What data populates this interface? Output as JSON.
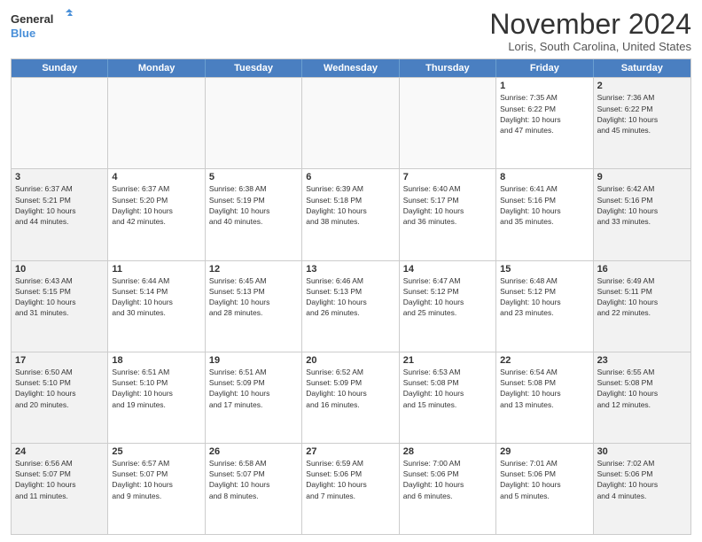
{
  "logo": {
    "line1": "General",
    "line2": "Blue"
  },
  "title": "November 2024",
  "location": "Loris, South Carolina, United States",
  "weekdays": [
    "Sunday",
    "Monday",
    "Tuesday",
    "Wednesday",
    "Thursday",
    "Friday",
    "Saturday"
  ],
  "rows": [
    [
      {
        "day": "",
        "info": "",
        "empty": true
      },
      {
        "day": "",
        "info": "",
        "empty": true
      },
      {
        "day": "",
        "info": "",
        "empty": true
      },
      {
        "day": "",
        "info": "",
        "empty": true
      },
      {
        "day": "",
        "info": "",
        "empty": true
      },
      {
        "day": "1",
        "info": "Sunrise: 7:35 AM\nSunset: 6:22 PM\nDaylight: 10 hours\nand 47 minutes."
      },
      {
        "day": "2",
        "info": "Sunrise: 7:36 AM\nSunset: 6:22 PM\nDaylight: 10 hours\nand 45 minutes.",
        "shaded": true
      }
    ],
    [
      {
        "day": "3",
        "info": "Sunrise: 6:37 AM\nSunset: 5:21 PM\nDaylight: 10 hours\nand 44 minutes.",
        "shaded": true
      },
      {
        "day": "4",
        "info": "Sunrise: 6:37 AM\nSunset: 5:20 PM\nDaylight: 10 hours\nand 42 minutes."
      },
      {
        "day": "5",
        "info": "Sunrise: 6:38 AM\nSunset: 5:19 PM\nDaylight: 10 hours\nand 40 minutes."
      },
      {
        "day": "6",
        "info": "Sunrise: 6:39 AM\nSunset: 5:18 PM\nDaylight: 10 hours\nand 38 minutes."
      },
      {
        "day": "7",
        "info": "Sunrise: 6:40 AM\nSunset: 5:17 PM\nDaylight: 10 hours\nand 36 minutes."
      },
      {
        "day": "8",
        "info": "Sunrise: 6:41 AM\nSunset: 5:16 PM\nDaylight: 10 hours\nand 35 minutes."
      },
      {
        "day": "9",
        "info": "Sunrise: 6:42 AM\nSunset: 5:16 PM\nDaylight: 10 hours\nand 33 minutes.",
        "shaded": true
      }
    ],
    [
      {
        "day": "10",
        "info": "Sunrise: 6:43 AM\nSunset: 5:15 PM\nDaylight: 10 hours\nand 31 minutes.",
        "shaded": true
      },
      {
        "day": "11",
        "info": "Sunrise: 6:44 AM\nSunset: 5:14 PM\nDaylight: 10 hours\nand 30 minutes."
      },
      {
        "day": "12",
        "info": "Sunrise: 6:45 AM\nSunset: 5:13 PM\nDaylight: 10 hours\nand 28 minutes."
      },
      {
        "day": "13",
        "info": "Sunrise: 6:46 AM\nSunset: 5:13 PM\nDaylight: 10 hours\nand 26 minutes."
      },
      {
        "day": "14",
        "info": "Sunrise: 6:47 AM\nSunset: 5:12 PM\nDaylight: 10 hours\nand 25 minutes."
      },
      {
        "day": "15",
        "info": "Sunrise: 6:48 AM\nSunset: 5:12 PM\nDaylight: 10 hours\nand 23 minutes."
      },
      {
        "day": "16",
        "info": "Sunrise: 6:49 AM\nSunset: 5:11 PM\nDaylight: 10 hours\nand 22 minutes.",
        "shaded": true
      }
    ],
    [
      {
        "day": "17",
        "info": "Sunrise: 6:50 AM\nSunset: 5:10 PM\nDaylight: 10 hours\nand 20 minutes.",
        "shaded": true
      },
      {
        "day": "18",
        "info": "Sunrise: 6:51 AM\nSunset: 5:10 PM\nDaylight: 10 hours\nand 19 minutes."
      },
      {
        "day": "19",
        "info": "Sunrise: 6:51 AM\nSunset: 5:09 PM\nDaylight: 10 hours\nand 17 minutes."
      },
      {
        "day": "20",
        "info": "Sunrise: 6:52 AM\nSunset: 5:09 PM\nDaylight: 10 hours\nand 16 minutes."
      },
      {
        "day": "21",
        "info": "Sunrise: 6:53 AM\nSunset: 5:08 PM\nDaylight: 10 hours\nand 15 minutes."
      },
      {
        "day": "22",
        "info": "Sunrise: 6:54 AM\nSunset: 5:08 PM\nDaylight: 10 hours\nand 13 minutes."
      },
      {
        "day": "23",
        "info": "Sunrise: 6:55 AM\nSunset: 5:08 PM\nDaylight: 10 hours\nand 12 minutes.",
        "shaded": true
      }
    ],
    [
      {
        "day": "24",
        "info": "Sunrise: 6:56 AM\nSunset: 5:07 PM\nDaylight: 10 hours\nand 11 minutes.",
        "shaded": true
      },
      {
        "day": "25",
        "info": "Sunrise: 6:57 AM\nSunset: 5:07 PM\nDaylight: 10 hours\nand 9 minutes."
      },
      {
        "day": "26",
        "info": "Sunrise: 6:58 AM\nSunset: 5:07 PM\nDaylight: 10 hours\nand 8 minutes."
      },
      {
        "day": "27",
        "info": "Sunrise: 6:59 AM\nSunset: 5:06 PM\nDaylight: 10 hours\nand 7 minutes."
      },
      {
        "day": "28",
        "info": "Sunrise: 7:00 AM\nSunset: 5:06 PM\nDaylight: 10 hours\nand 6 minutes."
      },
      {
        "day": "29",
        "info": "Sunrise: 7:01 AM\nSunset: 5:06 PM\nDaylight: 10 hours\nand 5 minutes."
      },
      {
        "day": "30",
        "info": "Sunrise: 7:02 AM\nSunset: 5:06 PM\nDaylight: 10 hours\nand 4 minutes.",
        "shaded": true
      }
    ]
  ]
}
